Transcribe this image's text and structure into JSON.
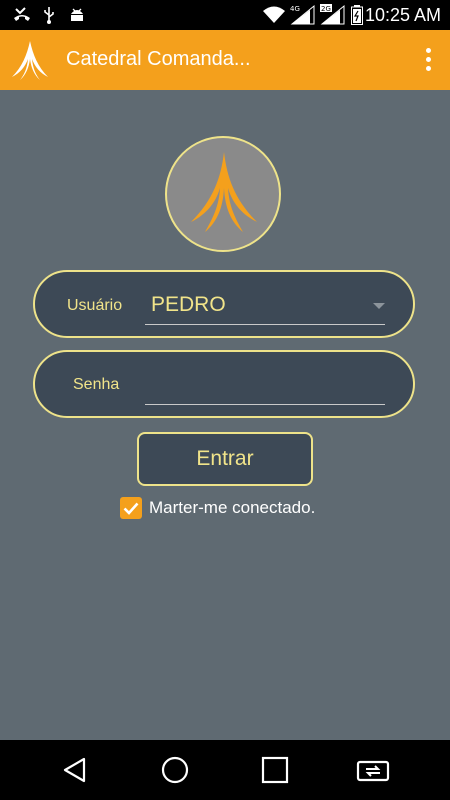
{
  "status_bar": {
    "time": "10:25 AM",
    "network_labels": [
      "4G",
      "2G"
    ],
    "icons": [
      "missed-call-icon",
      "usb-icon",
      "android-debug-icon",
      "wifi-icon",
      "signal-4g-icon",
      "signal-2g-icon",
      "battery-icon"
    ]
  },
  "app_bar": {
    "title": "Catedral Comanda...",
    "logo_icon": "cathedral-logo-icon",
    "menu_icon": "overflow-menu-icon",
    "color": "#f4a01c"
  },
  "login": {
    "user_label": "Usuário",
    "user_value": "PEDRO",
    "password_label": "Senha",
    "password_value": "",
    "submit_label": "Entrar",
    "remember_label": "Marter-me conectado.",
    "remember_checked": true
  },
  "nav_bar": {
    "icons": [
      "back-icon",
      "home-icon",
      "recents-icon",
      "switch-app-icon"
    ]
  },
  "colors": {
    "background": "#5f6a72",
    "field_background": "#3d4956",
    "border": "#eee38a",
    "text_accent": "#f1e48a",
    "brand": "#f4a01c"
  }
}
